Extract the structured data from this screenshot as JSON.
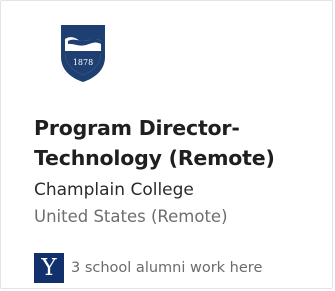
{
  "job": {
    "title": "Program Director-Technology (Remote)",
    "company": "Champlain College",
    "location": "United States (Remote)"
  },
  "company_logo": {
    "icon": "champlain-college-shield-logo",
    "year": "1878",
    "color": "#1d3f72"
  },
  "alumni": {
    "school_logo_letter": "Y",
    "school_logo_color": "#12306b",
    "text": "3 school alumni work here"
  }
}
